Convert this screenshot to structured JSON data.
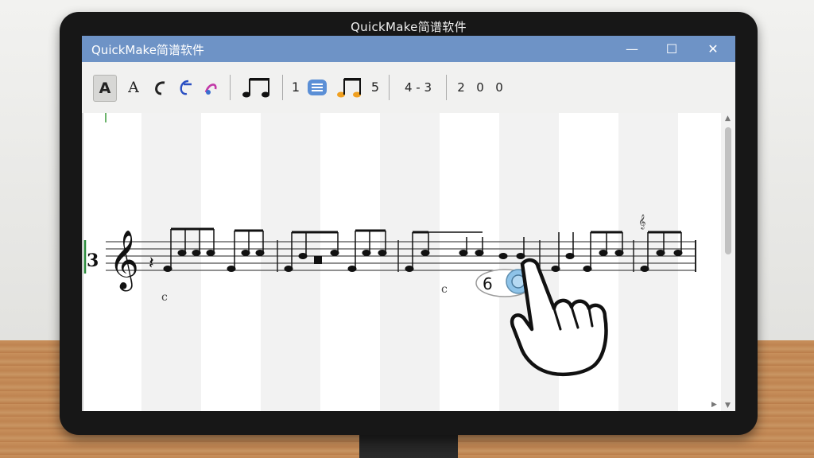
{
  "os": {
    "title": "QuickMake简谱软件"
  },
  "window": {
    "title": "QuickMake简谱软件",
    "controls": {
      "minimize": "—",
      "maximize": "☐",
      "close": "✕"
    }
  },
  "toolbar": {
    "font_a_bold": "A",
    "font_a": "A",
    "digit_1": "1",
    "digit_5": "5",
    "time_sig": "4 - 3",
    "d2": "2",
    "d0a": "0",
    "d0b": "0"
  },
  "score": {
    "key_label": "3",
    "clef": "𝄞",
    "tooltip_value": "6",
    "small_marks": [
      "c",
      "c"
    ]
  },
  "colors": {
    "titlebar": "#6e93c6",
    "note_accent": "#f0a020",
    "highlight": "#8ec3e8"
  }
}
